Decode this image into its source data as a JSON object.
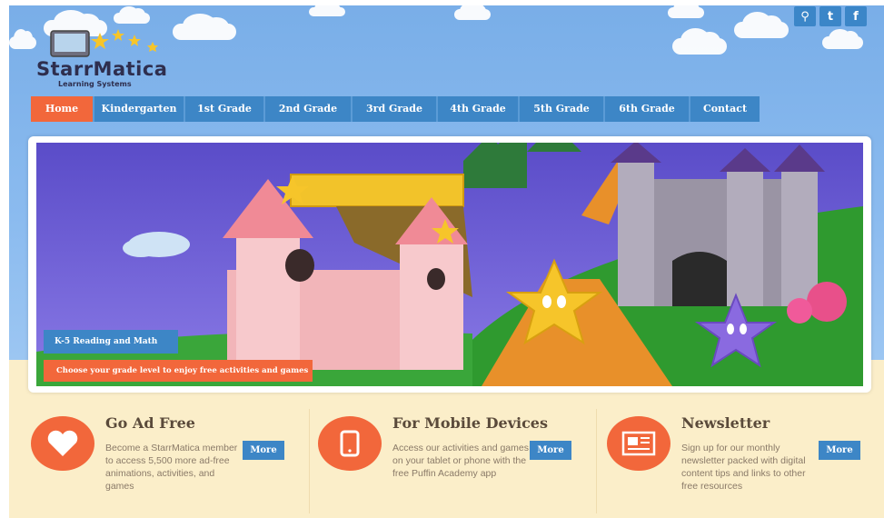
{
  "brand": {
    "name": "StarrMatica",
    "tagline": "Learning Systems"
  },
  "social": [
    {
      "icon": "search-icon",
      "glyph": "⚲"
    },
    {
      "icon": "twitter-icon",
      "glyph": "t"
    },
    {
      "icon": "facebook-icon",
      "glyph": "f"
    }
  ],
  "nav": [
    {
      "label": "Home",
      "active": true
    },
    {
      "label": "Kindergarten"
    },
    {
      "label": "1st Grade"
    },
    {
      "label": "2nd Grade"
    },
    {
      "label": "3rd Grade"
    },
    {
      "label": "4th Grade"
    },
    {
      "label": "5th Grade"
    },
    {
      "label": "6th Grade"
    },
    {
      "label": "Contact"
    }
  ],
  "hero": {
    "badge": "K-5 Reading and Math",
    "caption": "Choose your grade level to enjoy free activities and games"
  },
  "features": [
    {
      "title": "Go Ad Free",
      "description": "Become a StarrMatica member to access 5,500 more ad-free animations, activities, and games",
      "button": "More",
      "icon": "heart-icon"
    },
    {
      "title": "For Mobile Devices",
      "description": "Access our activities and games on your tablet or phone with the free Puffin Academy app",
      "button": "More",
      "icon": "tablet-icon"
    },
    {
      "title": "Newsletter",
      "description": "Sign up for our monthly newsletter packed with digital content tips and links to other free resources",
      "button": "More",
      "icon": "newspaper-icon"
    }
  ],
  "colors": {
    "accent": "#f2673b",
    "blue": "#3d86c6",
    "cream": "#fbeec9",
    "sky": "#8bbbef"
  }
}
